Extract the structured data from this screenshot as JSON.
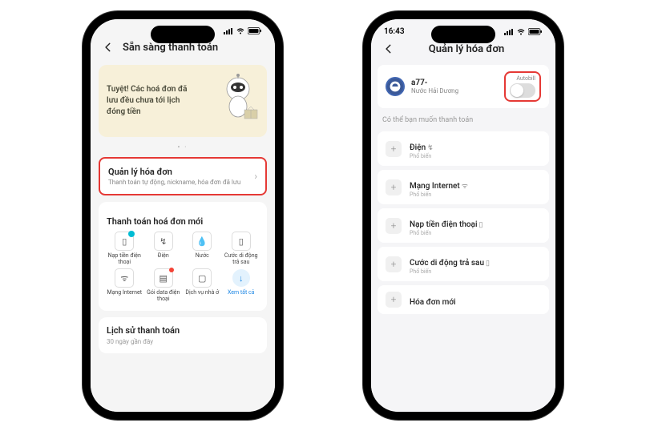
{
  "left": {
    "time": "",
    "header_title": "Sẵn sàng thanh toán",
    "hero_text": "Tuyệt! Các hoá đơn đã lưu đều chưa tới lịch đóng tiền",
    "manage": {
      "title": "Quản lý hóa đơn",
      "sub": "Thanh toán tự động, nickname, hóa đơn đã lưu"
    },
    "new_bill_title": "Thanh toán hoá đơn mới",
    "grid": [
      {
        "label": "Nạp tiền điện thoại"
      },
      {
        "label": "Điện"
      },
      {
        "label": "Nước"
      },
      {
        "label": "Cước di động trả sau"
      },
      {
        "label": "Mạng Internet"
      },
      {
        "label": "Gói data điện thoại"
      },
      {
        "label": "Dịch vụ nhà ở"
      },
      {
        "label": "Xem tất cả"
      }
    ],
    "history": {
      "title": "Lịch sử thanh toán",
      "sub": "30 ngày gần đây"
    }
  },
  "right": {
    "time": "16:43",
    "header_title": "Quản lý hóa đơn",
    "account": {
      "name": "a77-",
      "loc": "Nước Hải Dương"
    },
    "toggle_label": "Autobill",
    "hint": "Có thể bạn muốn thanh toán",
    "items": [
      {
        "title": "Điện",
        "icon": "↯",
        "sub": "Phổ biến"
      },
      {
        "title": "Mạng Internet",
        "icon": "ᯤ",
        "sub": "Phổ biến"
      },
      {
        "title": "Nạp tiền điện thoại",
        "icon": "▯",
        "sub": "Phổ biến"
      },
      {
        "title": "Cước di động trả sau",
        "icon": "▯",
        "sub": "Phổ biến"
      },
      {
        "title": "Hóa đơn mới",
        "icon": "",
        "sub": ""
      }
    ]
  }
}
